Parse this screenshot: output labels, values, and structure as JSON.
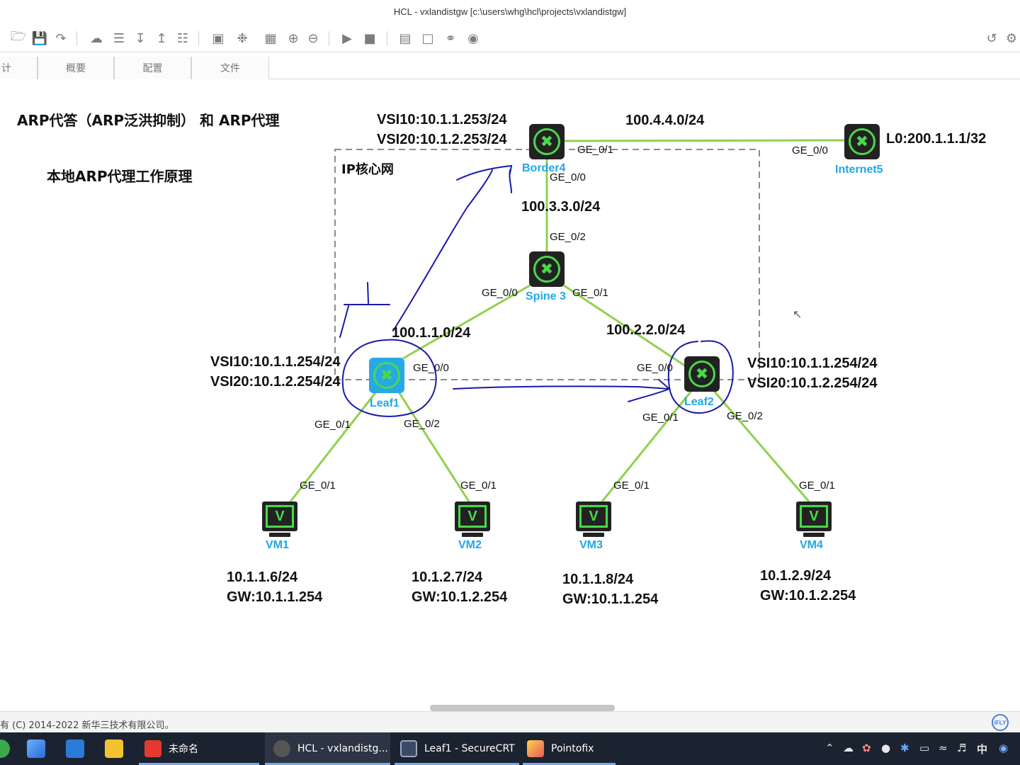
{
  "window": {
    "title": "HCL - vxlandistgw [c:\\users\\whg\\hcl\\projects\\vxlandistgw]"
  },
  "toolbar": {
    "icons": [
      "open-folder-icon",
      "save-icon",
      "export-icon",
      "cloud-icon",
      "layers-icon",
      "download-icon",
      "upload-icon",
      "report-icon",
      "screen-capture-icon",
      "settings-wheel-icon",
      "grid-icon",
      "zoom-in-icon",
      "zoom-out-icon",
      "play-icon",
      "stop-icon",
      "table-icon",
      "add-frame-icon",
      "add-link-icon",
      "camera-icon",
      "undo-icon",
      "gear-icon"
    ]
  },
  "tabs": [
    {
      "label": "计"
    },
    {
      "label": "概要"
    },
    {
      "label": "配置"
    },
    {
      "label": "文件"
    }
  ],
  "canvas": {
    "heading": "ARP代答（ARP泛洪抑制）  和 ARP代理",
    "subheading": "本地ARP代理工作原理",
    "core_label": "IP核心网",
    "networks": {
      "border_internet": "100.4.4.0/24",
      "border_spine": "100.3.3.0/24",
      "spine_leaf1": "100.1.1.0/24",
      "spine_leaf2": "100.2.2.0/24"
    },
    "devices": {
      "border": {
        "name": "Border4",
        "vsi10": "VSI10:10.1.1.253/24",
        "vsi20": "VSI20:10.1.2.253/24"
      },
      "internet": {
        "name": "Internet5",
        "loopback": "L0:200.1.1.1/32"
      },
      "spine": {
        "name": "Spine 3"
      },
      "leaf1": {
        "name": "Leaf1",
        "vsi10": "VSI10:10.1.1.254/24",
        "vsi20": "VSI20:10.1.2.254/24"
      },
      "leaf2": {
        "name": "Leaf2",
        "vsi10": "VSI10:10.1.1.254/24",
        "vsi20": "VSI20:10.1.2.254/24"
      }
    },
    "vms": [
      {
        "name": "VM1",
        "ip": "10.1.1.6/24",
        "gw": "GW:10.1.1.254"
      },
      {
        "name": "VM2",
        "ip": "10.1.2.7/24",
        "gw": "GW:10.1.2.254"
      },
      {
        "name": "VM3",
        "ip": "10.1.1.8/24",
        "gw": "GW:10.1.1.254"
      },
      {
        "name": "VM4",
        "ip": "10.1.2.9/24",
        "gw": "GW:10.1.2.254"
      }
    ],
    "ports": {
      "border_ge01": "GE_0/1",
      "border_ge00": "GE_0/0",
      "internet_ge00": "GE_0/0",
      "spine_ge02": "GE_0/2",
      "spine_ge00": "GE_0/0",
      "spine_ge01": "GE_0/1",
      "leaf1_ge00": "GE_0/0",
      "leaf1_ge01": "GE_0/1",
      "leaf1_ge02": "GE_0/2",
      "leaf2_ge00": "GE_0/0",
      "leaf2_ge01": "GE_0/1",
      "leaf2_ge02": "GE_0/2",
      "vm1_ge01": "GE_0/1",
      "vm2_ge01": "GE_0/1",
      "vm3_ge01": "GE_0/1",
      "vm4_ge01": "GE_0/1"
    },
    "colors": {
      "link": "#8fd14f",
      "device_label": "#1fa7e4",
      "annotation": "#1a1aa8"
    }
  },
  "statusbar": {
    "copyright": "有 (C) 2014-2022 新华三技术有限公司。",
    "badge": "iFLY"
  },
  "taskbar": {
    "apps": [
      {
        "label": "未命名"
      },
      {
        "label": "HCL - vxlandistg..."
      },
      {
        "label": "Leaf1 - SecureCRT"
      },
      {
        "label": "Pointofix"
      }
    ],
    "tray": {
      "ime": "中"
    }
  }
}
